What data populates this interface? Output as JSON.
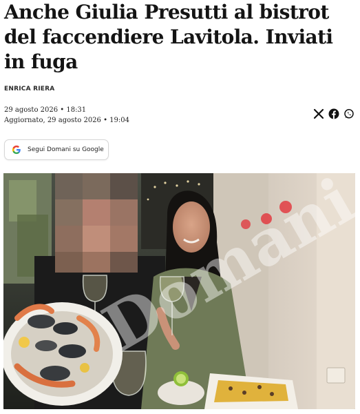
{
  "article": {
    "title": "Anche Giulia Presutti al bistrot del faccendiere Lavitola. Inviati in fuga",
    "author": "ENRICA RIERA",
    "published": "29 agosto 2026 • 18:31",
    "updated": "Aggiornato, 29 agosto 2026 • 19:04"
  },
  "share": {
    "icons": [
      "x-icon",
      "facebook-icon",
      "whatsapp-icon"
    ]
  },
  "follow_button": {
    "label": "Segui Domani su Google",
    "icon": "google-icon"
  },
  "photo": {
    "watermark": "Domani",
    "accent_color": "#e2323a"
  }
}
